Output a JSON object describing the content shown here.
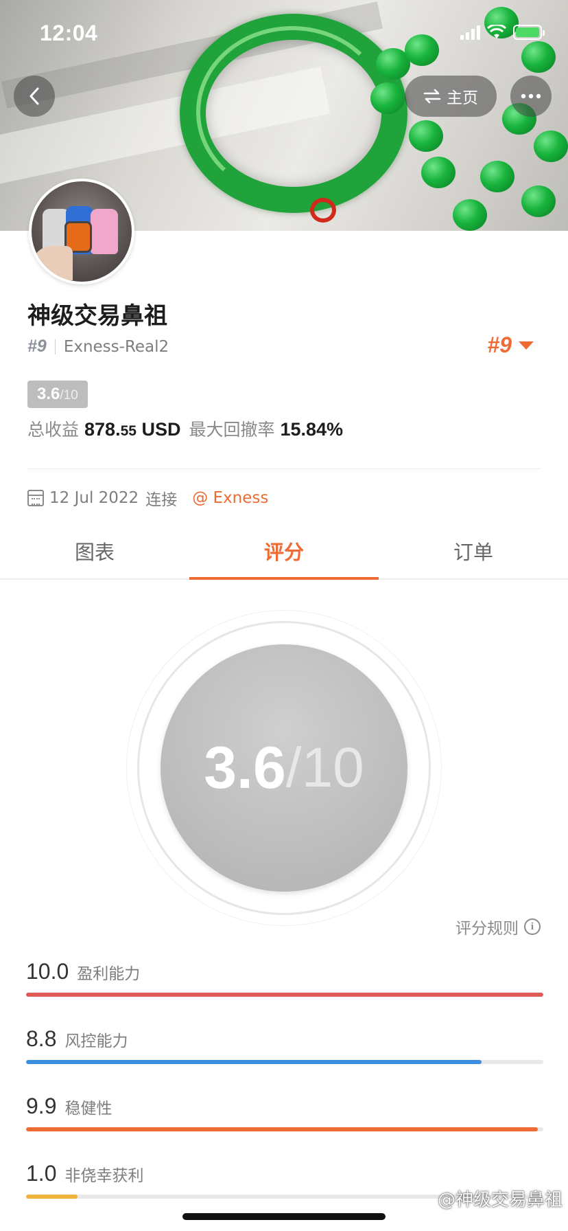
{
  "status_bar": {
    "time": "12:04"
  },
  "nav": {
    "home_label": "主页"
  },
  "profile": {
    "name": "神级交易鼻祖",
    "rank": "#9",
    "account": "Exness-Real2",
    "rank_badge": "#9",
    "score": "3.6",
    "score_max": "/10",
    "total_profit_label": "总收益",
    "total_profit_main": "878.",
    "total_profit_cents": "55",
    "total_profit_currency": " USD",
    "max_drawdown_label": "最大回撤率",
    "max_drawdown_value": "15.84%",
    "connect_date": "12 Jul 2022",
    "connect_label": "连接",
    "broker": "@ Exness"
  },
  "tabs": [
    {
      "label": "图表",
      "active": false
    },
    {
      "label": "评分",
      "active": true
    },
    {
      "label": "订单",
      "active": false
    }
  ],
  "gauge": {
    "value": "3.6",
    "max": "/10"
  },
  "rules_label": "评分规则",
  "metrics": [
    {
      "value": "10.0",
      "label": "盈利能力",
      "fraction": 1.0,
      "color": "#e05a5a"
    },
    {
      "value": "8.8",
      "label": "风控能力",
      "fraction": 0.88,
      "color": "#3b8fe0"
    },
    {
      "value": "9.9",
      "label": "稳健性",
      "fraction": 0.99,
      "color": "#ee6b34"
    },
    {
      "value": "1.0",
      "label": "非侥幸获利",
      "fraction": 0.1,
      "color": "#f0b23a"
    }
  ],
  "watermark": "@神级交易鼻祖",
  "colors": {
    "accent": "#ee6b34",
    "muted": "#8a8a8a",
    "badge": "#bdbdbd"
  }
}
